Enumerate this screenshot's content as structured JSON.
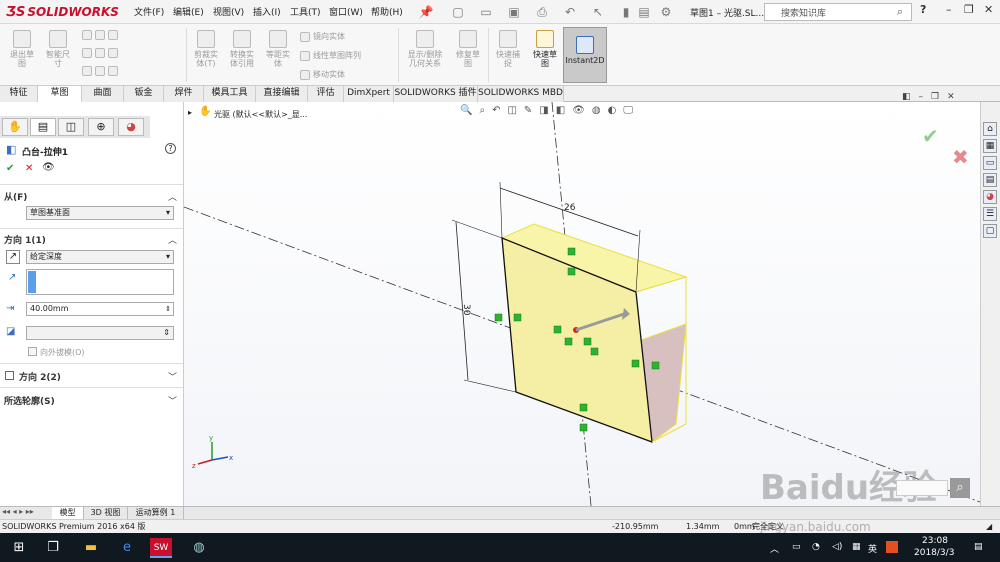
{
  "app": {
    "logo_text": "SOLIDWORKS",
    "menu": [
      "文件(F)",
      "编辑(E)",
      "视图(V)",
      "插入(I)",
      "工具(T)",
      "窗口(W)",
      "帮助(H)"
    ],
    "document_title": "草图1 – 光驱.SL...",
    "search_placeholder": "搜索知识库",
    "help_label": "?"
  },
  "ribbon": {
    "buttons": [
      {
        "label": "退出草\n图"
      },
      {
        "label": "智能尺\n寸"
      },
      {
        "label": "剪裁实\n体(T)"
      },
      {
        "label": "转换实\n体引用"
      },
      {
        "label": "等距实\n体"
      },
      {
        "label": "显示/删除\n几何关系"
      },
      {
        "label": "修复草\n图"
      },
      {
        "label": "快速捕\n捉"
      },
      {
        "label": "快速草\n图"
      },
      {
        "label": "Instant2D"
      }
    ],
    "small": [
      "镜向实体",
      "线性草图阵列",
      "移动实体"
    ]
  },
  "tabs": [
    "特征",
    "草图",
    "曲面",
    "钣金",
    "焊件",
    "模具工具",
    "直接编辑",
    "评估",
    "DimXpert",
    "SOLIDWORKS 插件",
    "SOLIDWORKS MBD"
  ],
  "active_tab": "草图",
  "property_manager": {
    "title": "凸台-拉伸1",
    "help": "?",
    "ok": "✔",
    "cancel": "✕",
    "preview": "👁",
    "from_label": "从(F)",
    "from_value": "草图基准面",
    "dir1_label": "方向 1(1)",
    "dir1_type": "给定深度",
    "depth_value": "40.00mm",
    "draft_label": "向外拔模(O)",
    "dir2_label": "方向 2(2)",
    "contours_label": "所选轮廓(S)"
  },
  "viewport": {
    "tree_label": "光驱 (默认<<默认>_显...",
    "dimension_1": "26",
    "dimension_2": "30",
    "origin_axes": {
      "x": "x",
      "y": "y",
      "z": "z"
    }
  },
  "bottom_tabs": [
    "模型",
    "3D 视图",
    "运动算例 1"
  ],
  "active_bottom_tab": "模型",
  "status": {
    "product": "SOLIDWORKS Premium 2016 x64 版",
    "x": "-210.95mm",
    "y": "1.34mm",
    "z": "0mm",
    "state": "完全定义"
  },
  "taskbar": {
    "lang": "英",
    "time": "23:08",
    "date": "2018/3/3"
  },
  "watermark": {
    "text": "Baidu经验",
    "url": "jingyan.baidu.com"
  }
}
